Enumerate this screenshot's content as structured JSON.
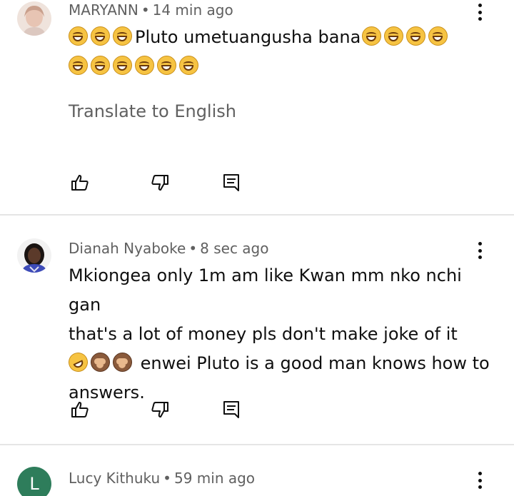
{
  "comments": [
    {
      "author": "MARYANN",
      "time": "14 min ago",
      "lines": [
        {
          "emojis_before": [
            "joy",
            "joy",
            "joy"
          ],
          "text": "Pluto umetuangusha bana",
          "emojis_after": [
            "joy",
            "joy",
            "joy",
            "joy"
          ]
        },
        {
          "emojis_before": [
            "joy",
            "joy",
            "joy",
            "joy",
            "joy",
            "joy"
          ],
          "text": "",
          "emojis_after": []
        }
      ],
      "translate_label": "Translate to English"
    },
    {
      "author": "Dianah Nyaboke",
      "time": "8 sec ago",
      "line1": "Mkiongea only 1m am like Kwan mm nko nchi gan",
      "line2": "that's a lot of money pls don't make joke of it",
      "line3_emojis": [
        "rofl",
        "see-no-evil-monkey",
        "see-no-evil-monkey"
      ],
      "line3_text": "enwei Pluto is a good man knows how to",
      "line4": "answers."
    },
    {
      "author": "Lucy Kithuku",
      "time": "59 min ago",
      "avatar_letter": "L"
    }
  ],
  "separator": "•",
  "icons": {
    "like": "thumb-up-icon",
    "dislike": "thumb-down-icon",
    "reply": "comment-icon",
    "more": "more-vertical-icon"
  },
  "colors": {
    "text_primary": "#0f0f0f",
    "text_secondary": "#606060",
    "divider": "#e5e5e5",
    "avatar_letter_bg": "#2e7d5b"
  }
}
